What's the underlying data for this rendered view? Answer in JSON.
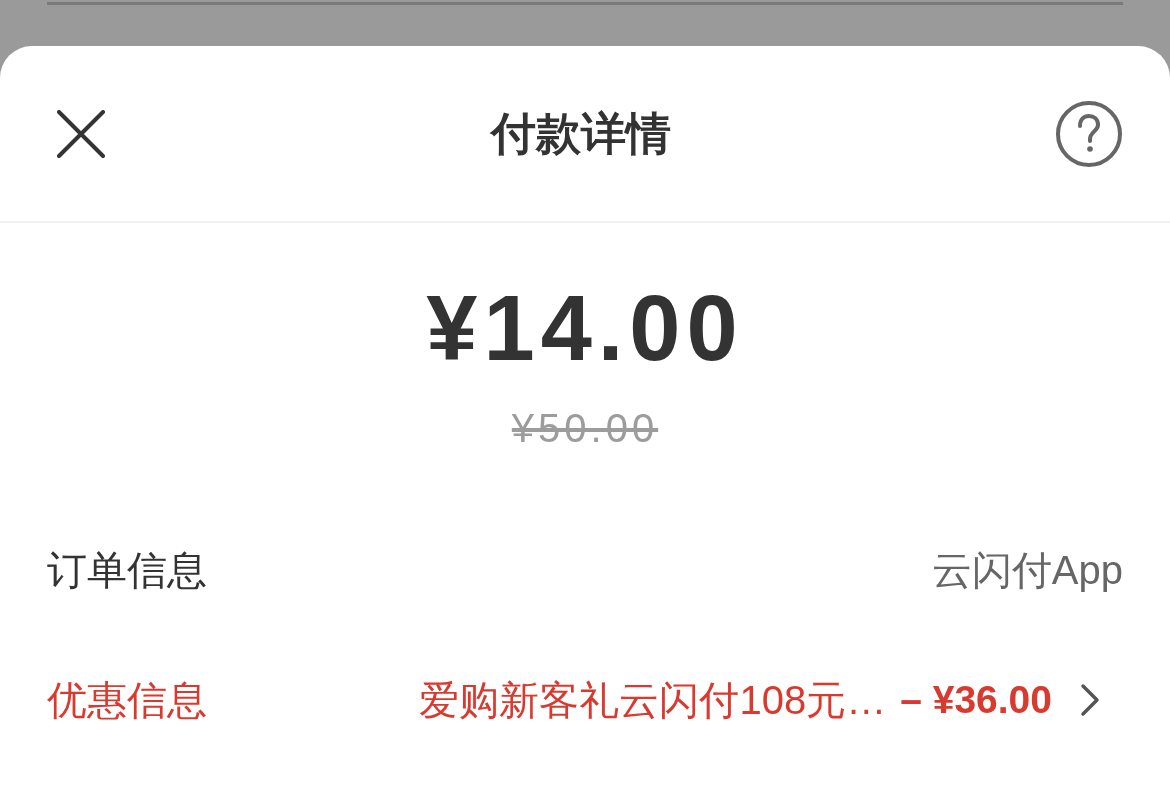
{
  "sheet": {
    "title": "付款详情"
  },
  "payment": {
    "amount": "¥14.00",
    "original_amount": "¥50.00"
  },
  "rows": [
    {
      "kind": "info",
      "label": "订单信息",
      "value": "云闪付App"
    },
    {
      "kind": "discount",
      "label": "优惠信息",
      "value": "爱购新客礼云闪付108元…",
      "amount": "– ¥36.00"
    }
  ]
}
